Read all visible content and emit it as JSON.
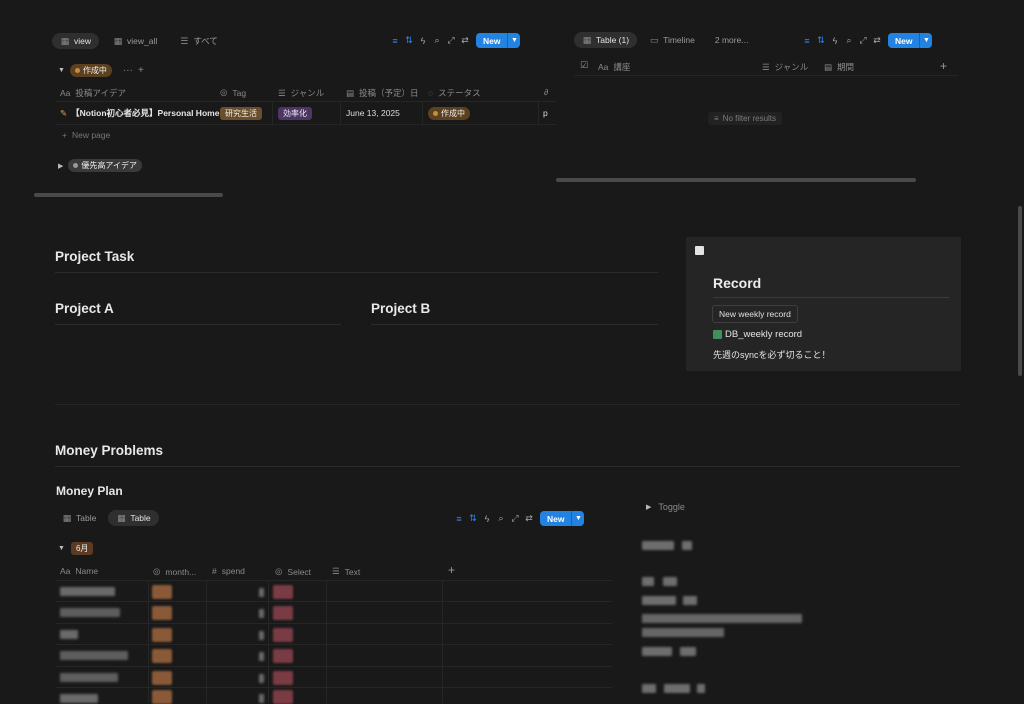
{
  "left_db": {
    "tabs": [
      {
        "label": "view",
        "icon": "table-icon",
        "active": true
      },
      {
        "label": "view_all",
        "icon": "table-icon",
        "active": false
      },
      {
        "label": "すべて",
        "icon": "list-icon",
        "active": false
      }
    ],
    "new_label": "New",
    "group1": {
      "label": "作成中",
      "color": "#a8722f"
    },
    "columns": [
      "投稿アイデア",
      "Tag",
      "ジャンル",
      "投稿（予定）日",
      "ステータス"
    ],
    "row": {
      "title": "【Notion初心者必見】Personal Homeの",
      "tag": "研究生活",
      "genre": "効率化",
      "date": "June 13, 2025",
      "status": "作成中",
      "extra": "p"
    },
    "new_page": "New page",
    "group2": {
      "label": "優先高アイデア"
    }
  },
  "right_db": {
    "tabs": [
      {
        "label": "Table (1)",
        "active": true
      },
      {
        "label": "Timeline",
        "active": false
      },
      {
        "label": "2 more...",
        "active": false
      }
    ],
    "new_label": "New",
    "columns": [
      "講座",
      "ジャンル",
      "期間"
    ],
    "empty": "No filter results"
  },
  "project_task": {
    "title": "Project Task",
    "a": "Project A",
    "b": "Project B"
  },
  "record": {
    "title": "Record",
    "button": "New weekly record",
    "link": "DB_weekly record",
    "note": "先週のsyncを必ず切ること！"
  },
  "money": {
    "title": "Money Problems",
    "plan_title": "Money Plan",
    "tabs": [
      {
        "label": "Table",
        "active": false
      },
      {
        "label": "Table",
        "active": true
      }
    ],
    "new_label": "New",
    "group": "6月",
    "columns": [
      "Name",
      "month...",
      "spend",
      "Select",
      "Text"
    ],
    "toggle": "Toggle"
  },
  "colors": {
    "accent": "#2383e2",
    "bg": "#191919",
    "callout_bg": "#252525"
  }
}
